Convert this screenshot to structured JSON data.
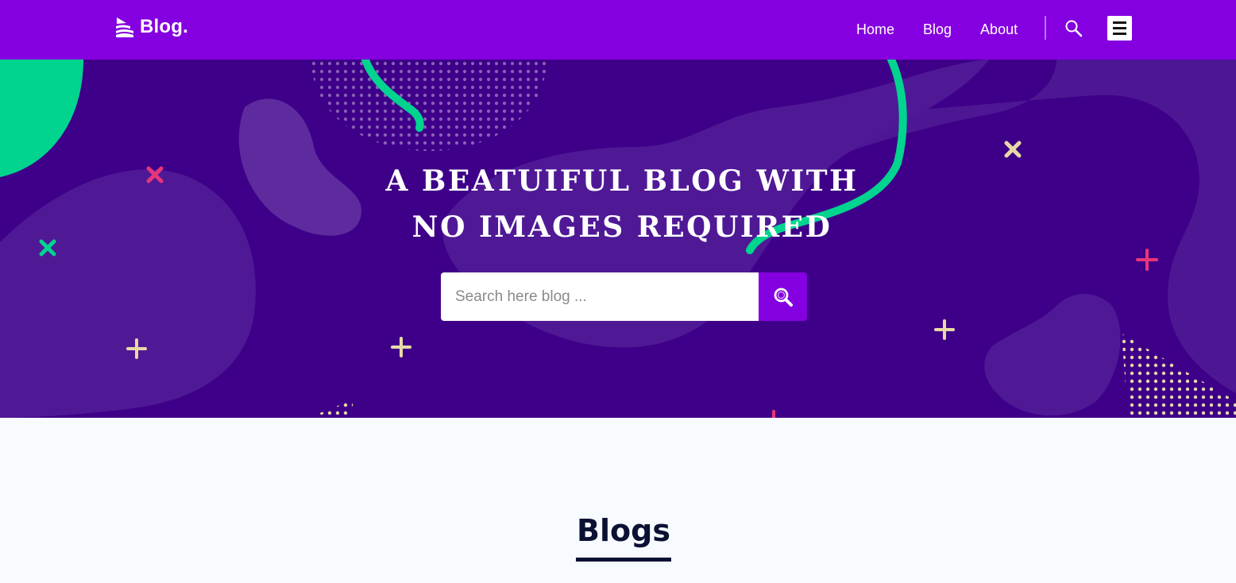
{
  "brand": {
    "name": "Blog.",
    "icon": "layers-icon"
  },
  "nav": {
    "links": [
      {
        "label": "Home"
      },
      {
        "label": "Blog"
      },
      {
        "label": "About"
      }
    ],
    "search_icon": "search-icon",
    "menu_icon": "hamburger-menu-icon"
  },
  "hero": {
    "title": "A BEATUIFUL BLOG WITH NO IMAGES REQUIRED",
    "search": {
      "placeholder": "Search here blog ...",
      "value": "",
      "button_icon": "magnifier-icon"
    }
  },
  "blogs": {
    "title": "Blogs"
  },
  "colors": {
    "nav_bg": "#8500e0",
    "hero_bg": "#3f0089",
    "accent_green": "#00d48e",
    "accent_pink": "#e8357a",
    "accent_cream": "#e8d9a6",
    "page_bg": "#f7fafe",
    "heading": "#0b1133"
  }
}
